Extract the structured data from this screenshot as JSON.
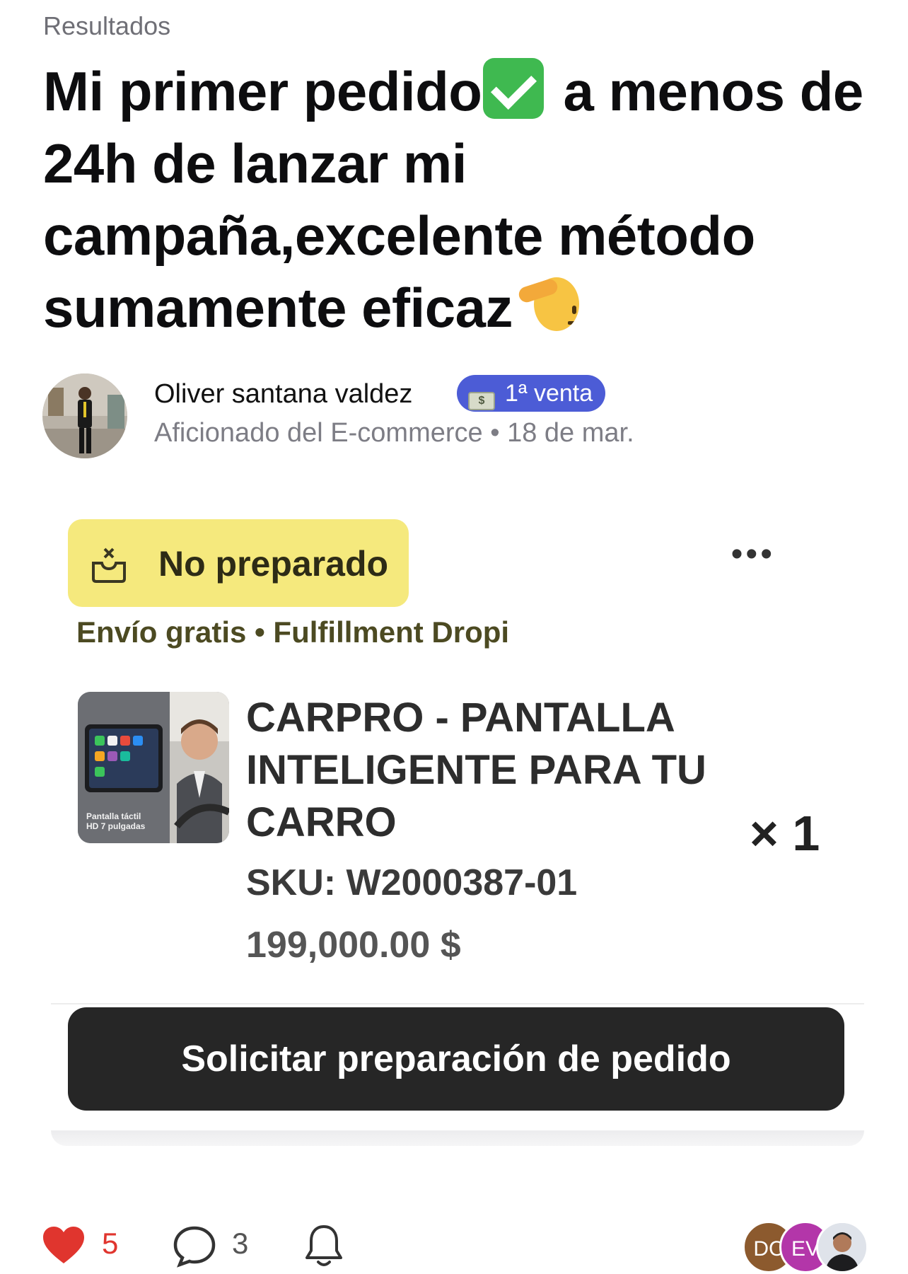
{
  "breadcrumb": "Resultados",
  "post": {
    "title_part1": "Mi primer pedido",
    "title_part2": " a menos de 24h de lanzar mi campaña,excelente método sumamente eficaz",
    "title_emoji_1": "check-mark-icon",
    "title_emoji_2": "saluting-face-icon"
  },
  "author": {
    "name": "Oliver santana valdez",
    "badge_label": "1ª venta",
    "badge_icon": "dollar-banknote-icon",
    "role": "Aficionado del E-commerce",
    "separator": "•",
    "date": "18 de mar."
  },
  "order_card": {
    "status_label": "No preparado",
    "status_icon": "box-x-icon",
    "shipping_info": "Envío gratis • Fulfillment Dropi",
    "product": {
      "name": "CARPRO - PANTALLA INTELIGENTE PARA TU CARRO",
      "image_caption": "Pantalla táctil HD 7 pulgadas",
      "quantity": "× 1",
      "sku": "SKU: W2000387-01",
      "price": "199,000.00 $"
    },
    "cta_label": "Solicitar preparación de pedido"
  },
  "footer": {
    "likes": "5",
    "comments": "3",
    "participants": [
      {
        "initials": "DC",
        "color": "#8c5a2e"
      },
      {
        "initials": "EV",
        "color": "#b336a9"
      },
      {
        "initials": "",
        "color": "#dfe3ea"
      }
    ]
  },
  "colors": {
    "badge": "#4c5cd6",
    "status_pill": "#f5e97d",
    "cta": "#262626",
    "heart": "#e0352e"
  }
}
